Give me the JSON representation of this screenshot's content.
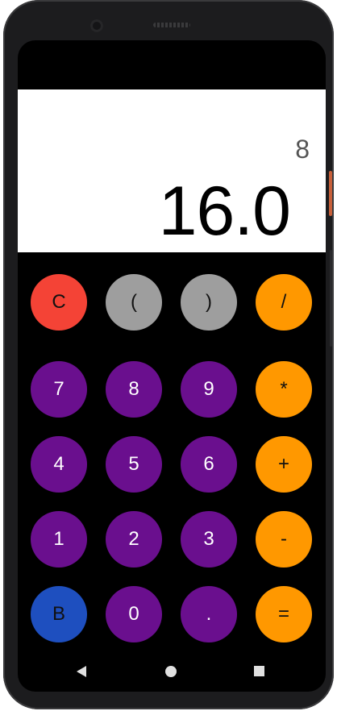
{
  "display": {
    "expression": "8",
    "result": "16.0"
  },
  "keys": [
    {
      "label": "C",
      "color": "#f44336",
      "text_color": "dark"
    },
    {
      "label": "(",
      "color": "#9e9e9e",
      "text_color": "dark"
    },
    {
      "label": ")",
      "color": "#9e9e9e",
      "text_color": "dark"
    },
    {
      "label": "/",
      "color": "#ff9800",
      "text_color": "dark"
    },
    {
      "label": "7",
      "color": "#6a0f8e",
      "text_color": "light"
    },
    {
      "label": "8",
      "color": "#6a0f8e",
      "text_color": "light"
    },
    {
      "label": "9",
      "color": "#6a0f8e",
      "text_color": "light"
    },
    {
      "label": "*",
      "color": "#ff9800",
      "text_color": "dark"
    },
    {
      "label": "4",
      "color": "#6a0f8e",
      "text_color": "light"
    },
    {
      "label": "5",
      "color": "#6a0f8e",
      "text_color": "light"
    },
    {
      "label": "6",
      "color": "#6a0f8e",
      "text_color": "light"
    },
    {
      "label": "+",
      "color": "#ff9800",
      "text_color": "dark"
    },
    {
      "label": "1",
      "color": "#6a0f8e",
      "text_color": "light"
    },
    {
      "label": "2",
      "color": "#6a0f8e",
      "text_color": "light"
    },
    {
      "label": "3",
      "color": "#6a0f8e",
      "text_color": "light"
    },
    {
      "label": "-",
      "color": "#ff9800",
      "text_color": "dark"
    },
    {
      "label": "B",
      "color": "#1e4fbf",
      "text_color": "dark"
    },
    {
      "label": "0",
      "color": "#6a0f8e",
      "text_color": "light"
    },
    {
      "label": ".",
      "color": "#6a0f8e",
      "text_color": "light"
    },
    {
      "label": "=",
      "color": "#ff9800",
      "text_color": "dark"
    }
  ],
  "nav": {
    "back_icon": "triangle-back-icon",
    "home_icon": "circle-home-icon",
    "recents_icon": "square-recents-icon"
  }
}
